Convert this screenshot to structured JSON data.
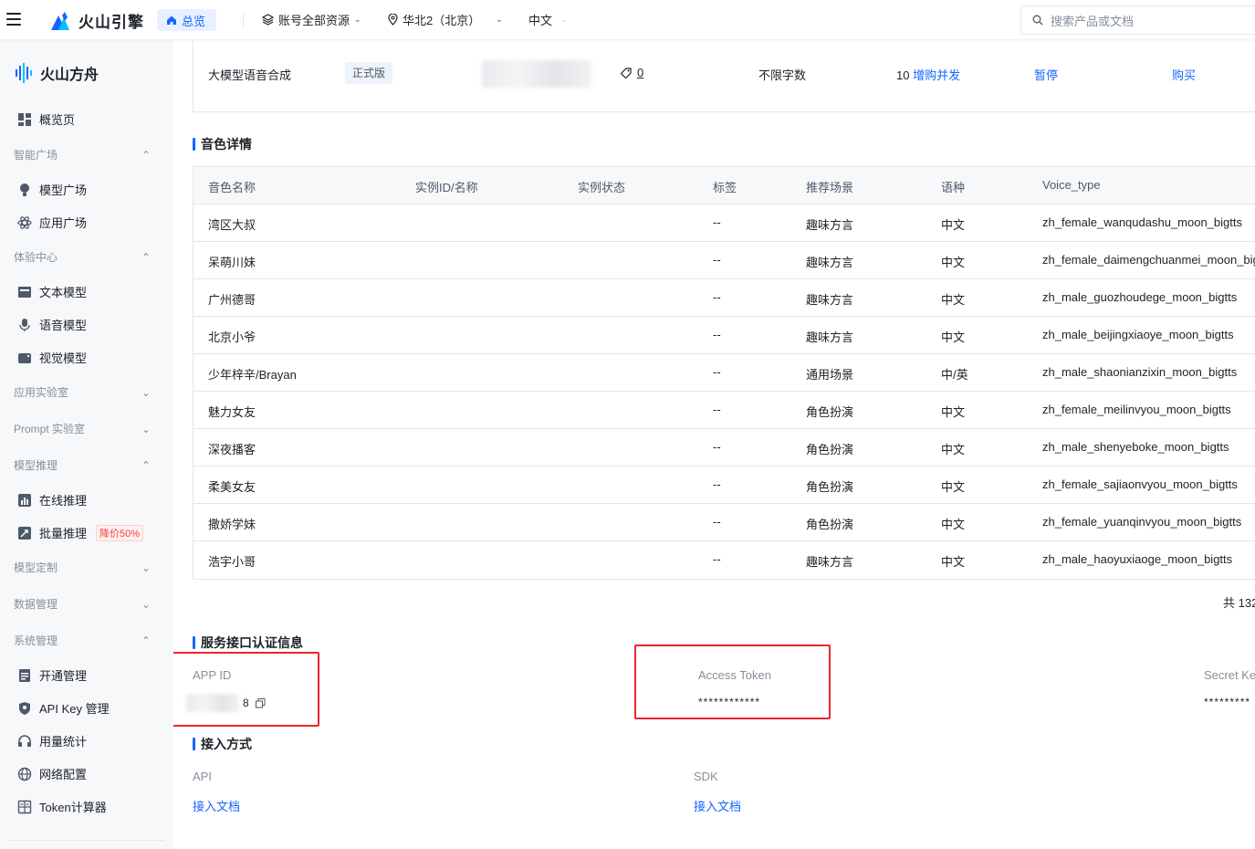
{
  "topbar": {
    "brand": "火山引擎",
    "home_tab": "总览",
    "account": "账号全部资源",
    "region": "华北2（北京）",
    "language": "中文",
    "search_placeholder": "搜索产品或文档"
  },
  "sidebar": {
    "product": "火山方舟",
    "overview": "概览页",
    "groups": {
      "smart": "智能广场",
      "experience": "体验中心",
      "app_lab": "应用实验室",
      "prompt_lab": "Prompt 实验室",
      "inference": "模型推理",
      "custom": "模型定制",
      "data": "数据管理",
      "system": "系统管理"
    },
    "items": {
      "model_square": "模型广场",
      "app_square": "应用广场",
      "text_model": "文本模型",
      "voice_model": "语音模型",
      "vision_model": "视觉模型",
      "online_infer": "在线推理",
      "batch_infer": "批量推理",
      "batch_badge": "降价50%",
      "activation": "开通管理",
      "api_key": "API Key 管理",
      "usage": "用量统计",
      "network": "网络配置",
      "token_calc": "Token计算器"
    }
  },
  "service": {
    "name": "大模型语音合成",
    "version_tag": "正式版",
    "tag_count": "0",
    "quota": "不限字数",
    "concurrency_num": "10",
    "concurrency_link": "增购并发",
    "pause": "暂停",
    "buy": "购买"
  },
  "voices": {
    "title": "音色详情",
    "headers": [
      "音色名称",
      "实例ID/名称",
      "实例状态",
      "标签",
      "推荐场景",
      "语种",
      "Voice_type"
    ],
    "rows": [
      {
        "name": "湾区大叔",
        "tag": "--",
        "scene": "趣味方言",
        "lang": "中文",
        "type": "zh_female_wanqudashu_moon_bigtts"
      },
      {
        "name": "呆萌川妹",
        "tag": "--",
        "scene": "趣味方言",
        "lang": "中文",
        "type": "zh_female_daimengchuanmei_moon_bigtts"
      },
      {
        "name": "广州德哥",
        "tag": "--",
        "scene": "趣味方言",
        "lang": "中文",
        "type": "zh_male_guozhoudege_moon_bigtts"
      },
      {
        "name": "北京小爷",
        "tag": "--",
        "scene": "趣味方言",
        "lang": "中文",
        "type": "zh_male_beijingxiaoye_moon_bigtts"
      },
      {
        "name": "少年梓辛/Brayan",
        "tag": "--",
        "scene": "通用场景",
        "lang": "中/英",
        "type": "zh_male_shaonianzixin_moon_bigtts"
      },
      {
        "name": "魅力女友",
        "tag": "--",
        "scene": "角色扮演",
        "lang": "中文",
        "type": "zh_female_meilinvyou_moon_bigtts"
      },
      {
        "name": "深夜播客",
        "tag": "--",
        "scene": "角色扮演",
        "lang": "中文",
        "type": "zh_male_shenyeboke_moon_bigtts"
      },
      {
        "name": "柔美女友",
        "tag": "--",
        "scene": "角色扮演",
        "lang": "中文",
        "type": "zh_female_sajiaonvyou_moon_bigtts"
      },
      {
        "name": "撒娇学妹",
        "tag": "--",
        "scene": "角色扮演",
        "lang": "中文",
        "type": "zh_female_yuanqinvyou_moon_bigtts"
      },
      {
        "name": "浩宇小哥",
        "tag": "--",
        "scene": "趣味方言",
        "lang": "中文",
        "type": "zh_male_haoyuxiaoge_moon_bigtts"
      }
    ],
    "total": "共 132"
  },
  "auth": {
    "title": "服务接口认证信息",
    "app_id_label": "APP ID",
    "app_id_tail": "8",
    "access_token_label": "Access Token",
    "access_token_value": "************",
    "secret_key_label": "Secret Ke",
    "secret_key_value": "*********"
  },
  "access": {
    "title": "接入方式",
    "api_label": "API",
    "api_link": "接入文档",
    "sdk_label": "SDK",
    "sdk_link": "接入文档"
  },
  "colors": {
    "accent": "#1664ff",
    "highlight": "#e8262d"
  }
}
